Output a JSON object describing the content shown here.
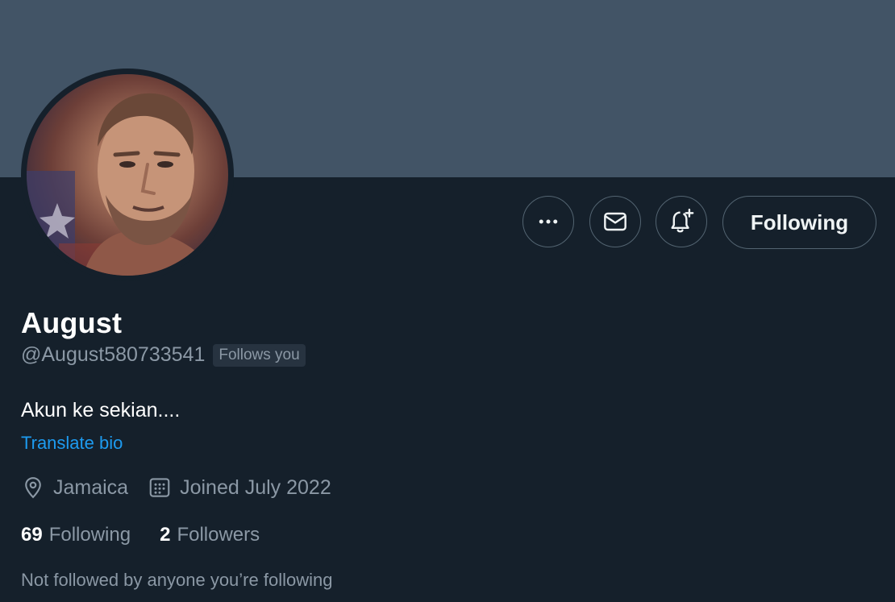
{
  "colors": {
    "banner": "#425466",
    "background": "#15202b",
    "secondary_text": "#8b98a5",
    "link": "#1d9bf0",
    "button_border": "#536471"
  },
  "header": {
    "banner_icon": "banner-image"
  },
  "profile": {
    "avatar_icon": "profile-photo",
    "display_name": "August",
    "handle": "@August580733541",
    "follows_you_badge": "Follows you",
    "bio": "Akun ke sekian....",
    "translate_label": "Translate bio",
    "location": "Jamaica",
    "joined": "Joined July 2022"
  },
  "actions": {
    "more_icon": "more-icon",
    "message_icon": "mail-icon",
    "notify_icon": "bell-plus-icon",
    "follow_label": "Following"
  },
  "stats": {
    "following_count": "69",
    "following_label": "Following",
    "followers_count": "2",
    "followers_label": "Followers"
  },
  "mutuals_text": "Not followed by anyone you’re following"
}
